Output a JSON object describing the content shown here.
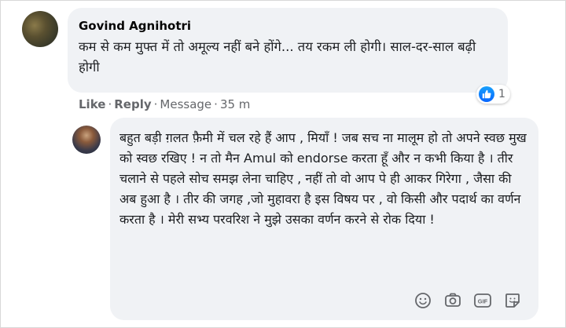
{
  "comment": {
    "author": "Govind Agnihotri",
    "text": "कम से कम मुफ्त में तो अमूल्य नहीं बने होंगे... तय रकम ली होगी। साल-दर-साल बढ़ी होगी",
    "actions": {
      "like": "Like",
      "reply": "Reply",
      "message": "Message",
      "time": "35 m"
    },
    "reaction_count": "1"
  },
  "reply_box": {
    "text": "बहुत बड़ी ग़लत फ़ैमी में चल रहे हैं आप , मियाँ  ! जब सच ना मालूम हो तो अपने स्वछ  मुख को स्वछ  रखिए  ! न तो मैन Amul को endorse करता हूँ और न कभी किया है  । तीर चलाने से पहले सोच समझ लेना चाहिए , नहीं तो वो आप पे ही आकर गिरेगा , जैसा की अब हुआ है  । तीर की जगह ,जो मुहावरा है  इस विषय पर , वो किसी और पदार्थ का वर्णन करता है  । मेरी सभ्य परवरिश ने मुझे उसका वर्णन करने से रोक दिया  !",
    "tools": [
      "emoji-icon",
      "camera-icon",
      "gif-icon",
      "sticker-icon"
    ],
    "gif_label": "GIF"
  },
  "colors": {
    "bubble": "#f0f2f5",
    "like_blue": "#0866ff",
    "muted": "#65676b"
  }
}
